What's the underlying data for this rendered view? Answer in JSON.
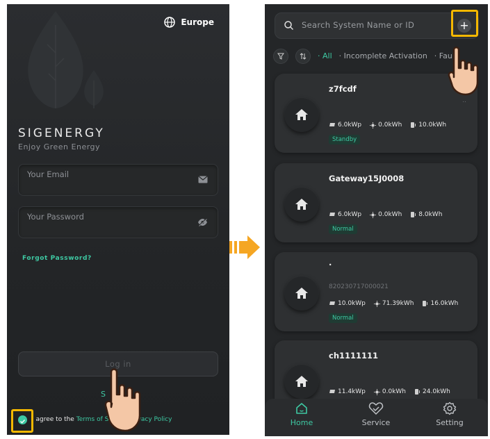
{
  "login": {
    "region": "Europe",
    "brand": "SIGENERGY",
    "tagline": "Enjoy Green Energy",
    "email_placeholder": "Your Email",
    "password_placeholder": "Your Password",
    "forgot_password": "Forgot Password?",
    "login_button": "Log in",
    "agree_prefix": "I agree to the",
    "terms_link": "Terms of S",
    "privacy_link": "Privacy Policy",
    "signup_fragment": "S"
  },
  "home": {
    "search_placeholder": "Search System Name or ID",
    "tabs": [
      "· All",
      "· Incomplete Activation",
      "· Fault"
    ],
    "active_tab": 0,
    "systems": [
      {
        "name": "z7fcdf",
        "id": "",
        "pv": "6.0kWp",
        "energy": "0.0kWh",
        "battery": "10.0kWh",
        "status": "Standby",
        "more": ".."
      },
      {
        "name": "Gateway15J0008",
        "id": "",
        "pv": "6.0kWp",
        "energy": "0.0kWh",
        "battery": "8.0kWh",
        "status": "Normal",
        "more": ""
      },
      {
        "name": ".",
        "id": "820230717000021",
        "pv": "10.0kWp",
        "energy": "71.39kWh",
        "battery": "16.0kWh",
        "status": "Normal",
        "more": ""
      },
      {
        "name": "ch1111111",
        "id": "",
        "pv": "11.4kWp",
        "energy": "0.0kWh",
        "battery": "24.0kWh",
        "status": "",
        "more": ""
      }
    ],
    "nav": [
      {
        "label": "Home",
        "icon": "home-icon",
        "active": true
      },
      {
        "label": "Service",
        "icon": "service-icon",
        "active": false
      },
      {
        "label": "Setting",
        "icon": "settings-icon",
        "active": false
      }
    ]
  },
  "colors": {
    "accent": "#3ec9a3",
    "highlight": "#f5b800",
    "background": "#242628"
  }
}
